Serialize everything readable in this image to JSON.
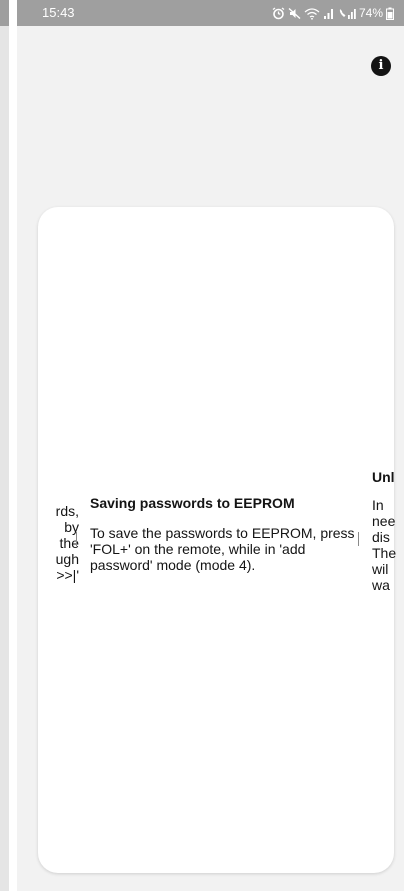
{
  "status_bar": {
    "time": "15:43",
    "battery": "74%",
    "icons": [
      "alarm-icon",
      "mute-icon",
      "wifi-icon",
      "signal-icon",
      "call-signal-icon",
      "battery-icon"
    ]
  },
  "info_button": {
    "glyph": "i",
    "icon": "info-icon"
  },
  "carousel": {
    "prev_slide": {
      "lines": [
        "rds,",
        "by",
        "the",
        "ugh",
        ">>|'"
      ]
    },
    "current_slide": {
      "title": "Saving passwords to EEPROM",
      "body": "To save the passwords to EEPROM, press 'FOL+' on the remote, while in 'add password' mode (mode 4)."
    },
    "next_slide": {
      "title": "Unl",
      "lines": [
        "In",
        "nee",
        "dis",
        "The",
        "wil",
        "wa"
      ]
    }
  },
  "colors": {
    "status_bar": "#9f9f9f",
    "background": "#f2f2f2",
    "card": "#ffffff",
    "text": "#141414"
  }
}
